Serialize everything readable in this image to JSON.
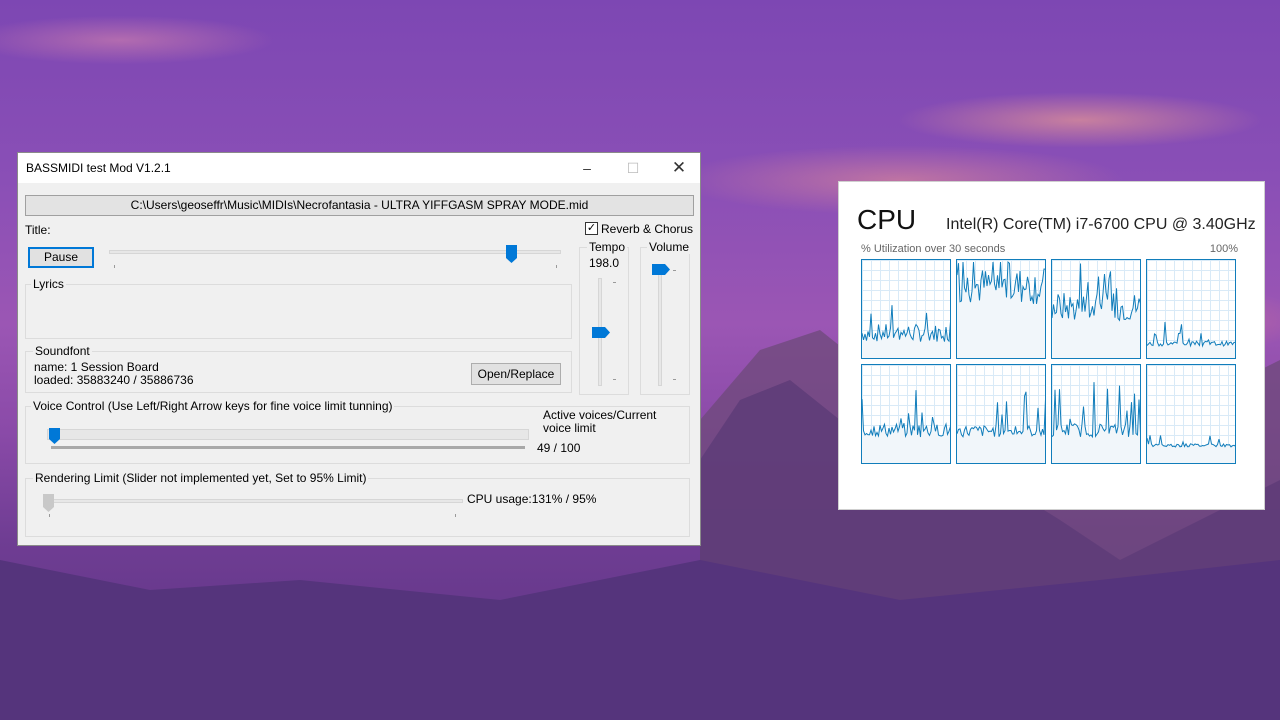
{
  "bassmidi": {
    "window_title": "BASSMIDI test Mod V1.2.1",
    "file_path": "C:\\Users\\geoseffr\\Music\\MIDIs\\Necrofantasia - ULTRA YIFFGASM SPRAY MODE.mid",
    "title_label": "Title:",
    "pause_label": "Pause",
    "position_fraction": 0.9,
    "reverb_label": "Reverb & Chorus",
    "reverb_checked": true,
    "tempo_label": "Tempo",
    "tempo_value": "198.0",
    "volume_label": "Volume",
    "tempo_level": 0.5,
    "volume_level": 1.0,
    "lyrics_label": "Lyrics",
    "soundfont_label": "Soundfont",
    "soundfont_name": "name: 1 Session Board",
    "soundfont_loaded": "loaded: 35883240 / 35886736",
    "open_replace_label": "Open/Replace",
    "voice_control_label": "Voice Control (Use Left/Right Arrow keys for fine voice limit tunning)",
    "active_voices_label": "Active voices/Current voice limit",
    "voices_value": "49 / 100",
    "voice_level": 0.0,
    "rendering_label": "Rendering Limit (Slider not implemented yet, Set to 95% Limit)",
    "cpu_usage": "CPU usage:131% / 95%"
  },
  "cpu_panel": {
    "heading": "CPU",
    "model": "Intel(R) Core(TM) i7-6700 CPU @ 3.40GHz",
    "subtitle": "% Utilization over 30 seconds",
    "max_label": "100%"
  },
  "colors": {
    "accent": "#0078d7",
    "graph_line": "#117dbb",
    "graph_fill": "#f1f6fa",
    "cpu_model_text": "#222222"
  }
}
